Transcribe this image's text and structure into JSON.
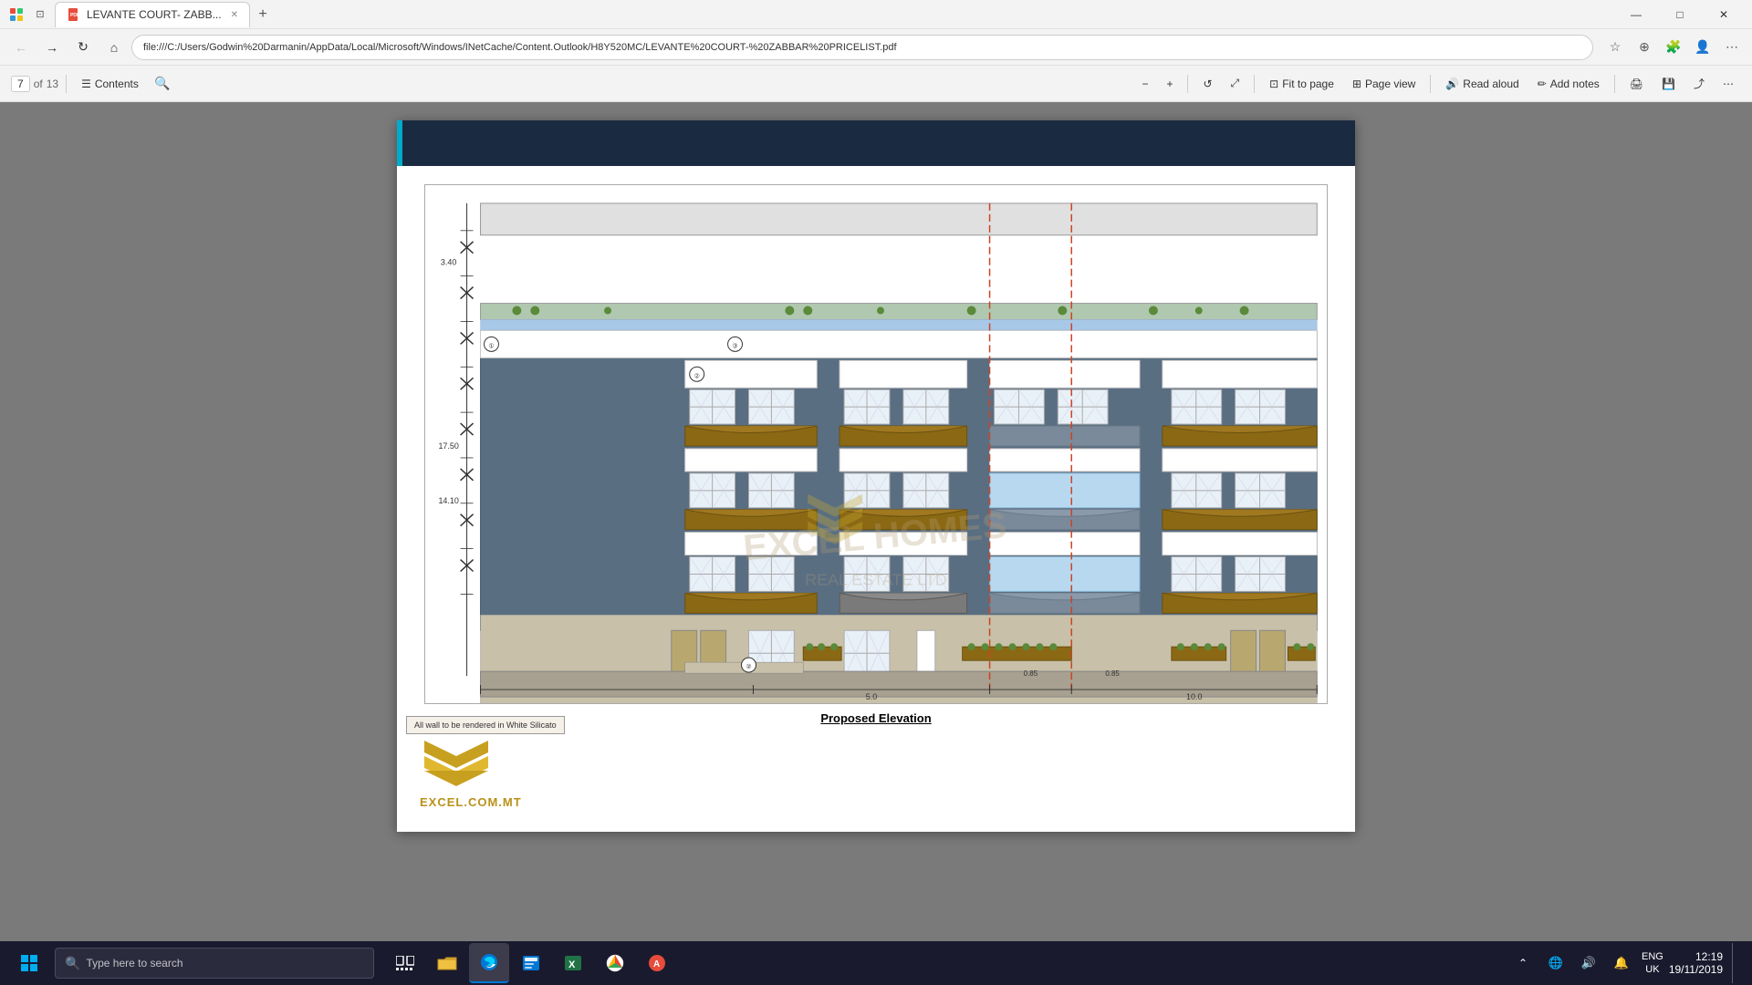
{
  "browser": {
    "tab_title": "LEVANTE COURT- ZABB...",
    "tab_add_label": "+",
    "address_bar": "file:///C:/Users/Godwin%20Darmanin/AppData/Local/Microsoft/Windows/INetCache/Content.Outlook/H8Y520MC/LEVANTE%20COURT-%20ZABBAR%20PRICELIST.pdf"
  },
  "toolbar": {
    "page_current": "7",
    "page_total": "13",
    "of_label": "of",
    "contents_label": "Contents",
    "zoom_out": "−",
    "zoom_in": "+",
    "fit_page_label": "Fit to page",
    "page_view_label": "Page view",
    "read_aloud_label": "Read aloud",
    "add_notes_label": "Add notes",
    "print_icon_label": "🖨",
    "more_label": "..."
  },
  "pdf": {
    "drawing_caption": "Proposed Elevation",
    "legend_text": "All wall to be rendered in White Silicato",
    "scale_values": [
      "3.40",
      "17.50",
      "14.10"
    ],
    "dimension_values": [
      "0.85",
      "0.85",
      "5.0",
      "10.0"
    ]
  },
  "logo": {
    "text": "EXCEL.COM.MT"
  },
  "taskbar": {
    "search_placeholder": "Type here to search",
    "time": "12:19",
    "date": "19/11/2019",
    "lang": "ENG\nUK"
  },
  "win_controls": {
    "minimize": "—",
    "maximize": "□",
    "close": "✕"
  }
}
